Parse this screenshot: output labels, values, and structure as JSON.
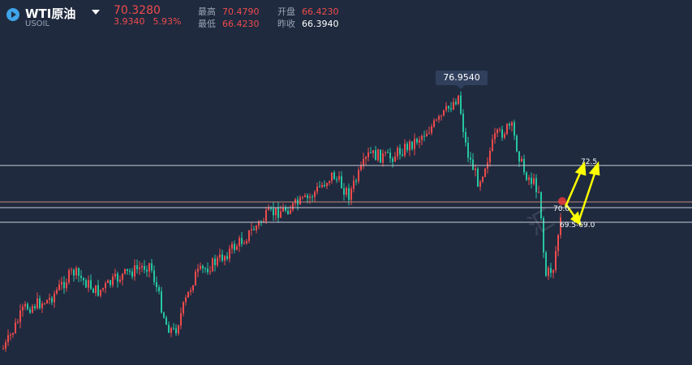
{
  "header": {
    "symbol_name": "WTI原油",
    "symbol_code": "USOIL",
    "price": "70.3280",
    "change": "3.9340",
    "change_pct": "5.93%",
    "high_label": "最高",
    "high_value": "70.4790",
    "open_label": "开盘",
    "open_value": "66.4230",
    "low_label": "最低",
    "low_value": "66.4230",
    "prev_close_label": "昨收",
    "prev_close_value": "66.3940"
  },
  "chart": {
    "peak_label": "76.9540",
    "level_70": "70.0",
    "level_72": "72.5",
    "level_range": "69.5-69.0",
    "watermark": "汇"
  },
  "colors": {
    "background": "#1f2a3f",
    "up": "#ef4b4b",
    "down": "#26c6a0",
    "arrow": "#ffff00",
    "level_line": "#c8ccd4"
  }
}
